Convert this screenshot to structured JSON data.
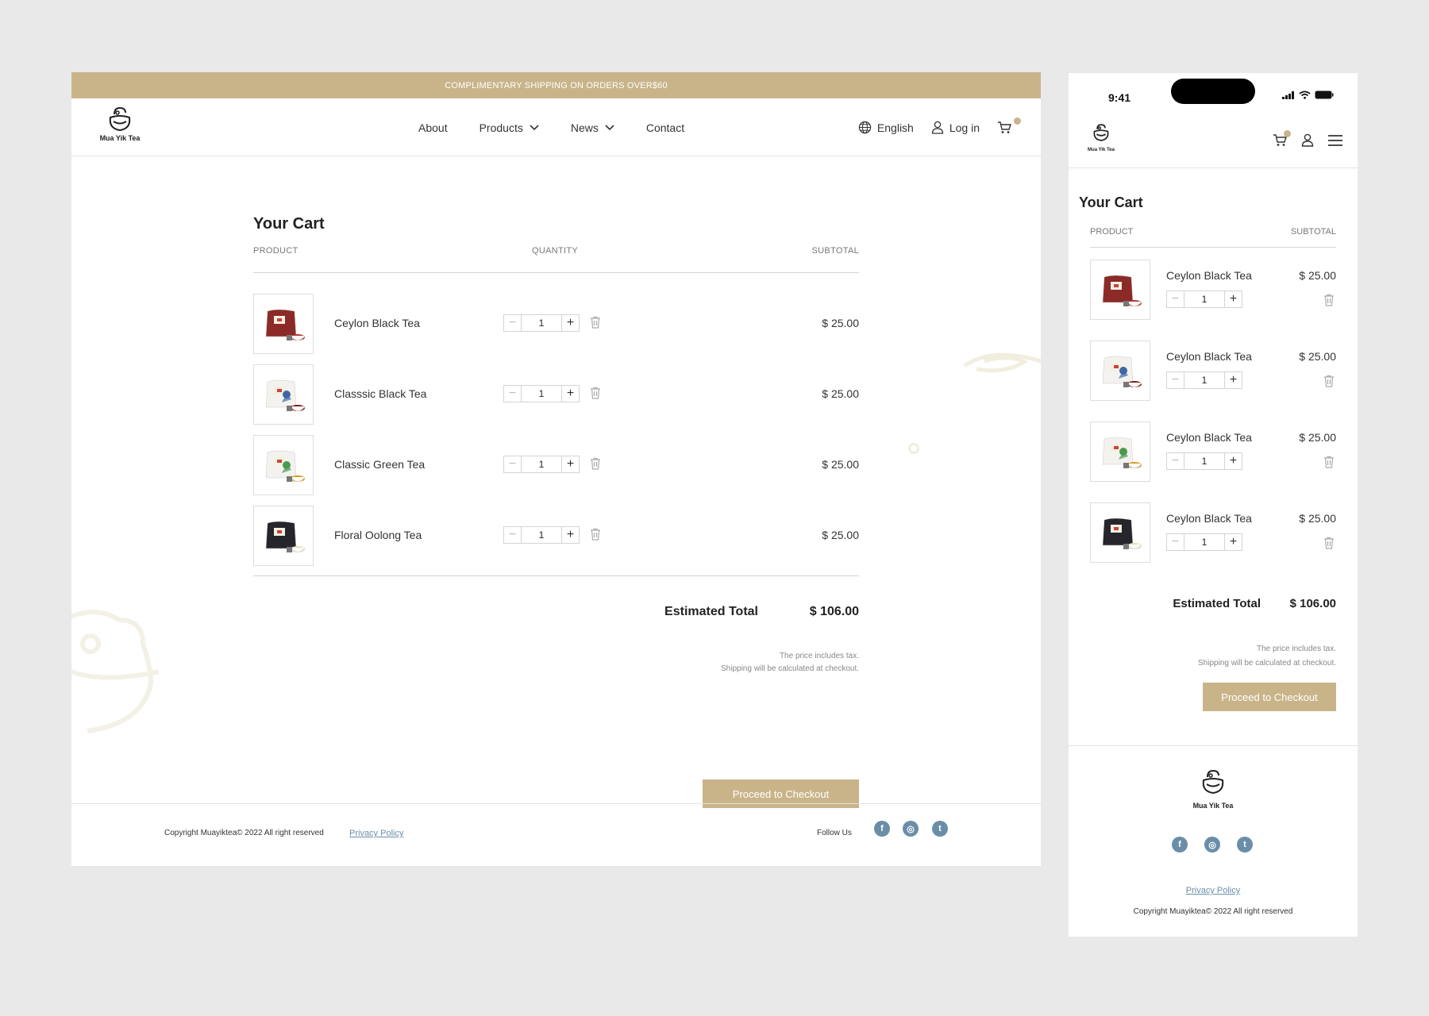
{
  "banner": {
    "text": "COMPLIMENTARY SHIPPING ON ORDERS OVER$60"
  },
  "brand": {
    "name": "Mua Yik Tea",
    "accent": "#c9b48a",
    "link_color": "#6a8ea8"
  },
  "nav": {
    "items": [
      {
        "label": "About",
        "has_dropdown": false
      },
      {
        "label": "Products",
        "has_dropdown": true
      },
      {
        "label": "News",
        "has_dropdown": true
      },
      {
        "label": "Contact",
        "has_dropdown": false
      }
    ],
    "language": "English",
    "login": "Log in"
  },
  "cart": {
    "title": "Your Cart",
    "headers": {
      "product": "PRODUCT",
      "quantity": "QUANTITY",
      "subtotal": "SUBTOTAL"
    },
    "items": [
      {
        "name": "Ceylon Black Tea",
        "qty": "1",
        "price": "$ 25.00",
        "pack": "red"
      },
      {
        "name": "Classsic Black Tea",
        "qty": "1",
        "price": "$ 25.00",
        "pack": "white-blue"
      },
      {
        "name": "Classic Green Tea",
        "qty": "1",
        "price": "$ 25.00",
        "pack": "white-green"
      },
      {
        "name": "Floral Oolong Tea",
        "qty": "1",
        "price": "$ 25.00",
        "pack": "black"
      }
    ],
    "total_label": "Estimated Total",
    "total_value": "$ 106.00",
    "note_tax": "The price includes tax.",
    "note_shipping": "Shipping will be calculated at checkout.",
    "checkout": "Proceed to Checkout"
  },
  "mobile": {
    "time": "9:41",
    "items": [
      {
        "name": "Ceylon Black Tea",
        "qty": "1",
        "price": "$ 25.00",
        "pack": "red"
      },
      {
        "name": "Ceylon Black Tea",
        "qty": "1",
        "price": "$ 25.00",
        "pack": "white-blue"
      },
      {
        "name": "Ceylon Black Tea",
        "qty": "1",
        "price": "$ 25.00",
        "pack": "white-green"
      },
      {
        "name": "Ceylon Black Tea",
        "qty": "1",
        "price": "$ 25.00",
        "pack": "black"
      }
    ]
  },
  "footer": {
    "copyright": "Copyright  Muayiktea© 2022 All right reserved",
    "privacy": "Privacy Policy",
    "follow": "Follow Us",
    "social": [
      {
        "icon": "facebook-icon",
        "glyph": "f"
      },
      {
        "icon": "instagram-icon",
        "glyph": "◎"
      },
      {
        "icon": "twitter-icon",
        "glyph": "t"
      }
    ]
  }
}
